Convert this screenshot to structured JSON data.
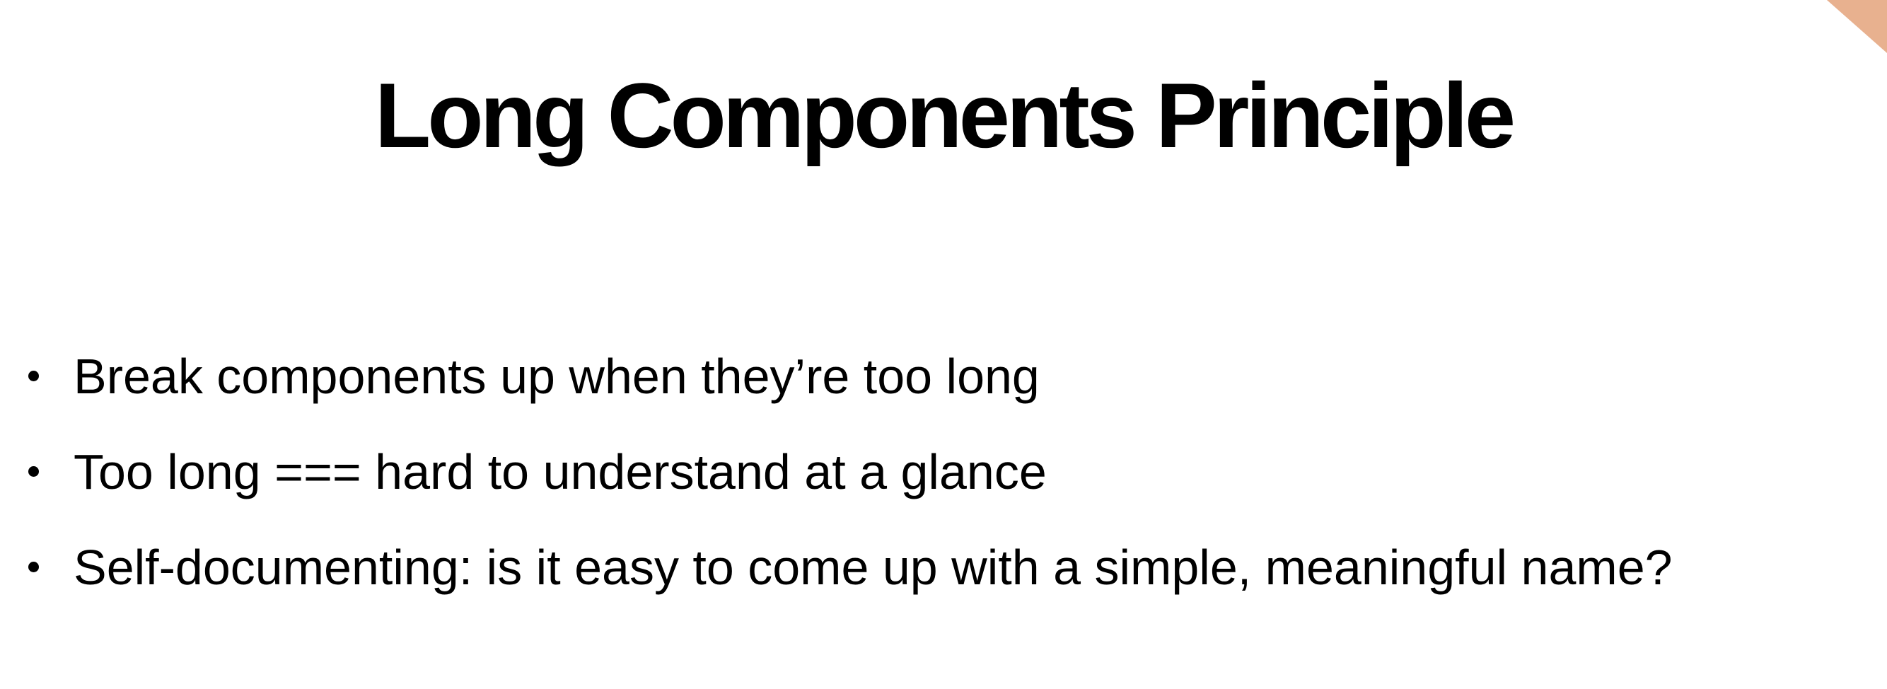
{
  "slide": {
    "title": "Long Components Principle",
    "bullets": [
      {
        "text": "Break components up when they’re too long"
      },
      {
        "text": "Too long === hard to understand at a glance"
      },
      {
        "text": "Self-documenting: is it easy to come up with a simple, meaningful name?"
      }
    ]
  },
  "colors": {
    "background": "#ffffff",
    "text": "#000000",
    "corner_accent": "#e8b18f"
  }
}
